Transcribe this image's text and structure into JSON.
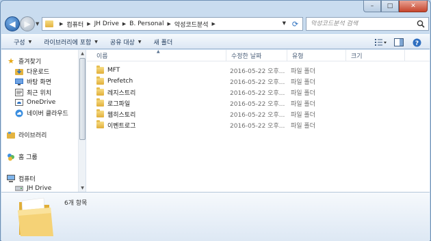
{
  "window": {
    "caption_buttons": [
      {
        "name": "minimize",
        "glyph": "–"
      },
      {
        "name": "maximize",
        "glyph": "□"
      },
      {
        "name": "close",
        "glyph": "✕"
      }
    ]
  },
  "address": {
    "crumbs": [
      "컴퓨터",
      "JH Drive",
      "B. Personal",
      "악성코드분석"
    ]
  },
  "search": {
    "placeholder": "악성코드분석 검색"
  },
  "toolbar": {
    "organize": "구성",
    "include_library": "라이브러리에 포함",
    "share": "공유 대상",
    "new_folder": "새 폴더"
  },
  "nav": {
    "favorites": "즐겨찾기",
    "downloads": "다운로드",
    "desktop": "바탕 화면",
    "recent": "최근 위치",
    "onedrive": "OneDrive",
    "naver_cloud": "네이버 클라우드",
    "libraries": "라이브러리",
    "homegroup": "홈 그룹",
    "computer": "컴퓨터",
    "jh_drive": "JH Drive"
  },
  "columns": {
    "name": "이름",
    "date": "수정한 날짜",
    "type": "유형",
    "size": "크기"
  },
  "files": [
    {
      "name": "MFT",
      "date": "2016-05-22 오후...",
      "type": "파일 폴더"
    },
    {
      "name": "Prefetch",
      "date": "2016-05-22 오후...",
      "type": "파일 폴더"
    },
    {
      "name": "레지스트리",
      "date": "2016-05-22 오후...",
      "type": "파일 폴더"
    },
    {
      "name": "로그파일",
      "date": "2016-05-22 오후...",
      "type": "파일 폴더"
    },
    {
      "name": "웹히스토리",
      "date": "2016-05-22 오후...",
      "type": "파일 폴더"
    },
    {
      "name": "이벤트로그",
      "date": "2016-05-22 오후...",
      "type": "파일 폴더"
    }
  ],
  "details": {
    "count": "6개 항목"
  },
  "colors": {
    "accent": "#2360a8",
    "folder": "#e8bf52",
    "close_button": "#c7452c"
  }
}
